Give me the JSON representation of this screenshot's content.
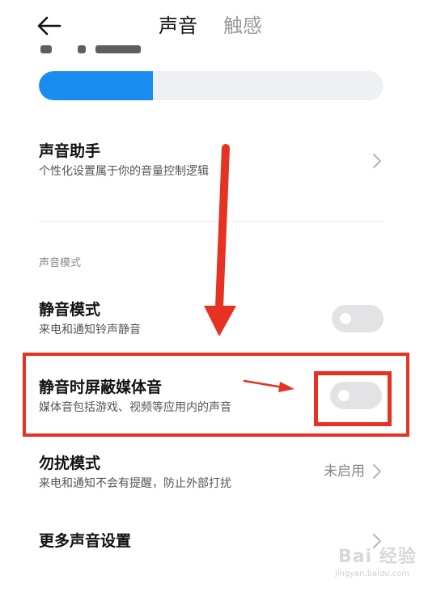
{
  "header": {
    "tab_sound": "声音",
    "tab_haptic": "触感"
  },
  "volume": {
    "level": 0.33
  },
  "assistant": {
    "title": "声音助手",
    "subtitle": "个性化设置属于你的音量控制逻辑"
  },
  "section": {
    "label": "声音模式"
  },
  "silent_mode": {
    "title": "静音模式",
    "subtitle": "来电和通知铃声静音",
    "enabled": false
  },
  "mute_media": {
    "title": "静音时屏蔽媒体音",
    "subtitle": "媒体音包括游戏、视频等应用内的声音",
    "enabled": false
  },
  "dnd": {
    "title": "勿扰模式",
    "subtitle": "来电和通知不会有提醒，防止外部打扰",
    "status": "未启用"
  },
  "more": {
    "title": "更多声音设置"
  },
  "watermark": {
    "main": "Bai 经验",
    "url": "jingyan.baidu.com"
  },
  "colors": {
    "accent": "#1a8cf0",
    "annotation": "#e53222"
  }
}
